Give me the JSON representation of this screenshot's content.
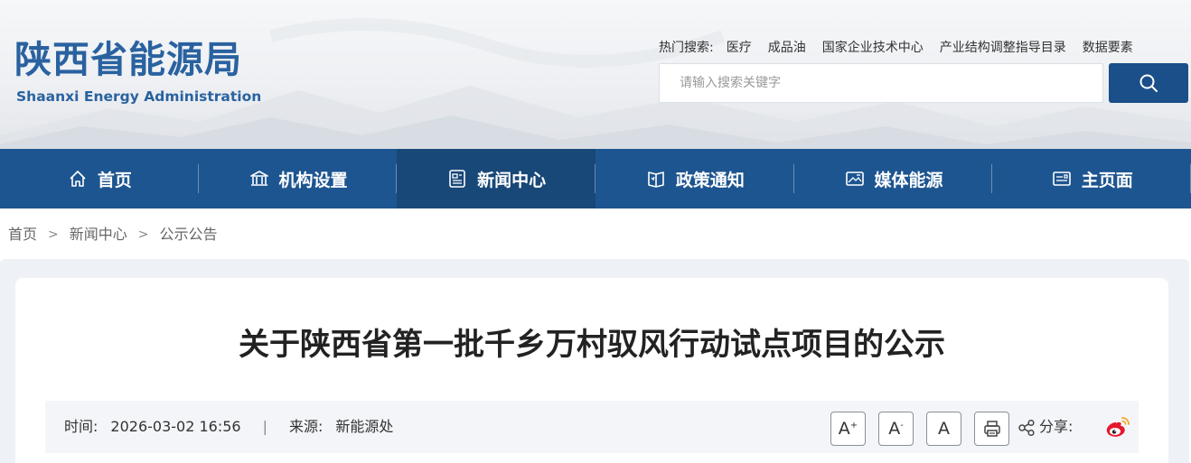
{
  "header": {
    "logo_cn": "陕西省能源局",
    "logo_en": "Shaanxi Energy Administration",
    "hot_search_label": "热门搜索:",
    "hot_search_items": [
      "医疗",
      "成品油",
      "国家企业技术中心",
      "产业结构调整指导目录",
      "数据要素"
    ],
    "search_placeholder": "请输入搜索关键字"
  },
  "nav": {
    "items": [
      {
        "label": "首页",
        "icon": "home-icon"
      },
      {
        "label": "机构设置",
        "icon": "institution-icon"
      },
      {
        "label": "新闻中心",
        "icon": "news-icon"
      },
      {
        "label": "政策通知",
        "icon": "policy-icon"
      },
      {
        "label": "媒体能源",
        "icon": "media-icon"
      },
      {
        "label": "主页面",
        "icon": "mainpage-icon"
      }
    ],
    "active_index": 2
  },
  "breadcrumb": {
    "items": [
      "首页",
      "新闻中心",
      "公示公告"
    ],
    "separator": ">"
  },
  "article": {
    "title": "关于陕西省第一批千乡万村驭风行动试点项目的公示",
    "time_label": "时间:",
    "time_value": "2026-03-02 16:56",
    "divider": "|",
    "source_label": "来源:",
    "source_value": "新能源处",
    "font_increase": "A",
    "font_increase_mark": "+",
    "font_decrease": "A",
    "font_decrease_mark": "-",
    "font_reset": "A",
    "share_label": "分享:"
  },
  "colors": {
    "brand": "#2a62a0",
    "nav_bg": "#1d5590",
    "nav_active": "#184878",
    "search_button": "#1a4f8a"
  }
}
